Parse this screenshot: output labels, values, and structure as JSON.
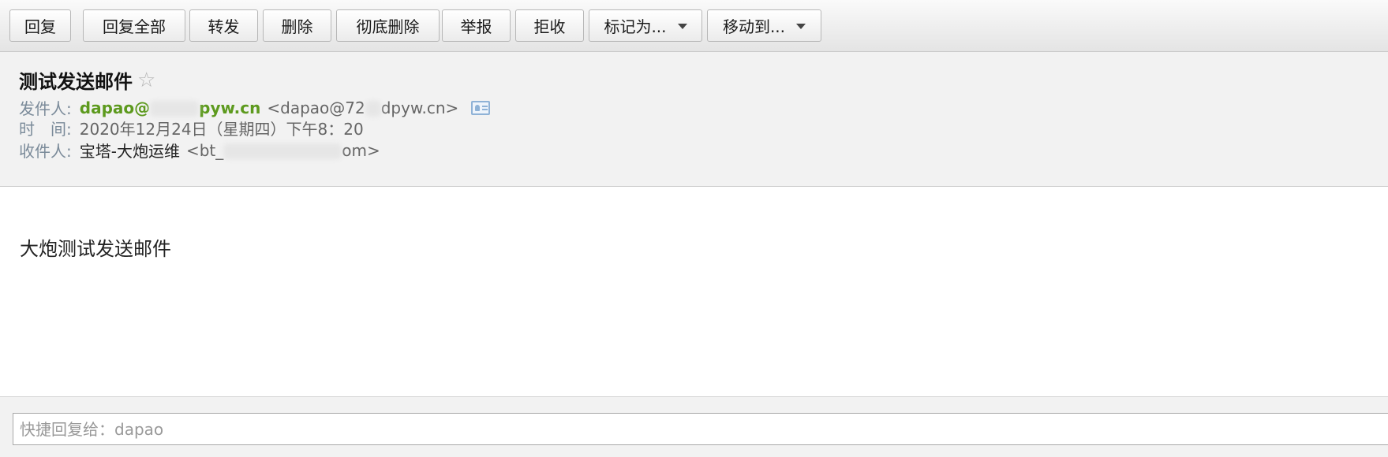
{
  "toolbar": {
    "reply_label": "回复",
    "reply_all_label": "回复全部",
    "forward_label": "转发",
    "delete_label": "删除",
    "delete_permanently_label": "彻底删除",
    "report_label": "举报",
    "reject_label": "拒收",
    "mark_as_label": "标记为...",
    "move_to_label": "移动到..."
  },
  "message": {
    "subject": "测试发送邮件",
    "sender_label": "发件人:",
    "sender_name_visible_start": "dapao@",
    "sender_name_visible_end": "pyw.cn",
    "sender_address_visible_start": "<dapao@72",
    "sender_address_visible_end": "dpyw.cn>",
    "time_label": "时　间:",
    "time_value": "2020年12月24日（星期四）下午8：20",
    "recipient_label": "收件人:",
    "recipient_name": "宝塔-大炮运维",
    "recipient_address_visible_start": "<bt_",
    "recipient_address_visible_end": "om>",
    "body": "大炮测试发送邮件"
  },
  "quick_reply": {
    "placeholder": "快捷回复给：dapao"
  },
  "colors": {
    "sender_name": "#5d9a1e",
    "label": "#7a8a99",
    "star": "#b5b5b5"
  }
}
